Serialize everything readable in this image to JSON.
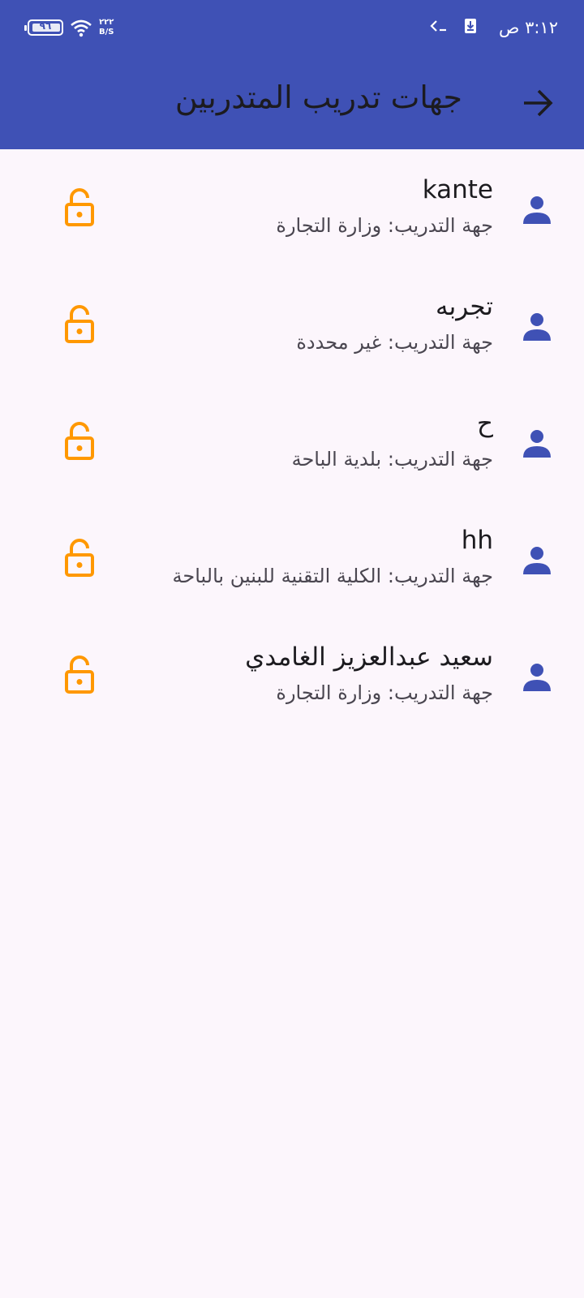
{
  "status_bar": {
    "time": "٣:١٢ ص",
    "battery_level": "٩٦",
    "net_speed_value": "٢٢٢",
    "net_speed_unit": "B/S"
  },
  "header": {
    "title": "جهات تدريب المتدربين",
    "back_icon": "arrow-right-icon"
  },
  "colors": {
    "primary": "#3f51b5",
    "lock_accent": "#ff9800",
    "background": "#fcf6fc"
  },
  "trainees": [
    {
      "name": "kante",
      "detail": "جهة التدريب: وزارة التجارة"
    },
    {
      "name": "تجربه",
      "detail": "جهة التدريب: غير محددة"
    },
    {
      "name": "ح",
      "detail": "جهة التدريب: بلدية الباحة"
    },
    {
      "name": "hh",
      "detail": "جهة التدريب: الكلية التقنية للبنين بالباحة"
    },
    {
      "name": "سعيد عبدالعزيز الغامدي",
      "detail": "جهة التدريب: وزارة التجارة"
    }
  ]
}
